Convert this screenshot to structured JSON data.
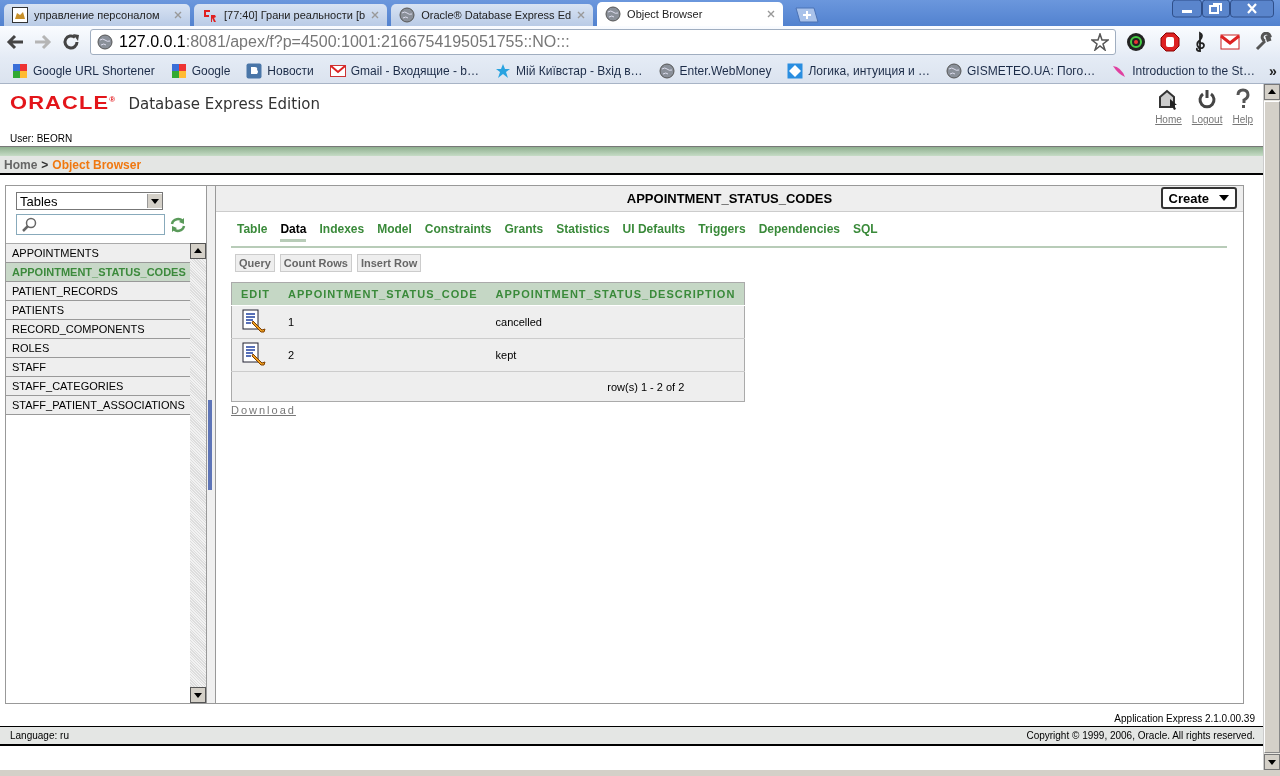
{
  "browser": {
    "tabs": [
      {
        "title": "управление персоналом",
        "selected": false
      },
      {
        "title": "[77:40] Грани реальности [b",
        "selected": false
      },
      {
        "title": "Oracle® Database Express Ed",
        "selected": false
      },
      {
        "title": "Object Browser",
        "selected": true
      }
    ],
    "address": {
      "host": "127.0.0.1",
      "rest": ":8081/apex/f?p=4500:1001:2166754195051755::NO:::"
    },
    "bookmarks": [
      "Google URL Shortener",
      "Google",
      "Новости",
      "Gmail - Входящие - b…",
      "Мій Київстар - Вхід в…",
      "Enter.WebMoney",
      "Логика, интуиция и …",
      "GISMETEO.UA: Пого…",
      "Introduction to the St…"
    ],
    "bookmarks_more": "»"
  },
  "header": {
    "logo": "ORACLE",
    "logo_mark": "®",
    "product": "Database Express Edition",
    "user": "User: BEORN",
    "nav": [
      "Home",
      "Logout",
      "Help"
    ]
  },
  "breadcrumb": {
    "items": [
      {
        "label": "Home",
        "selected": false
      },
      {
        "label": "Object Browser",
        "selected": true
      }
    ],
    "separator": ">"
  },
  "sidebar": {
    "object_type": "Tables",
    "items": [
      {
        "label": "APPOINTMENTS",
        "selected": false
      },
      {
        "label": "APPOINTMENT_STATUS_CODES",
        "selected": true
      },
      {
        "label": "PATIENT_RECORDS",
        "selected": false
      },
      {
        "label": "PATIENTS",
        "selected": false
      },
      {
        "label": "RECORD_COMPONENTS",
        "selected": false
      },
      {
        "label": "ROLES",
        "selected": false
      },
      {
        "label": "STAFF",
        "selected": false
      },
      {
        "label": "STAFF_CATEGORIES",
        "selected": false
      },
      {
        "label": "STAFF_PATIENT_ASSOCIATIONS",
        "selected": false
      }
    ]
  },
  "object": {
    "title": "APPOINTMENT_STATUS_CODES",
    "create_button": "Create",
    "tabs": [
      {
        "label": "Table",
        "selected": false
      },
      {
        "label": "Data",
        "selected": true
      },
      {
        "label": "Indexes",
        "selected": false
      },
      {
        "label": "Model",
        "selected": false
      },
      {
        "label": "Constraints",
        "selected": false
      },
      {
        "label": "Grants",
        "selected": false
      },
      {
        "label": "Statistics",
        "selected": false
      },
      {
        "label": "UI Defaults",
        "selected": false
      },
      {
        "label": "Triggers",
        "selected": false
      },
      {
        "label": "Dependencies",
        "selected": false
      },
      {
        "label": "SQL",
        "selected": false
      }
    ],
    "actions": [
      "Query",
      "Count Rows",
      "Insert Row"
    ],
    "table": {
      "columns": [
        "EDIT",
        "APPOINTMENT_STATUS_CODE",
        "APPOINTMENT_STATUS_DESCRIPTION"
      ],
      "rows": [
        [
          "",
          "1",
          "cancelled"
        ],
        [
          "",
          "2",
          "kept"
        ]
      ],
      "pagination": "row(s) 1 - 2 of 2"
    },
    "download": "Download"
  },
  "footer": {
    "version": "Application Express 2.1.0.00.39",
    "language": "Language: ru",
    "copyright": "Copyright © 1999, 2006, Oracle. All rights reserved."
  }
}
